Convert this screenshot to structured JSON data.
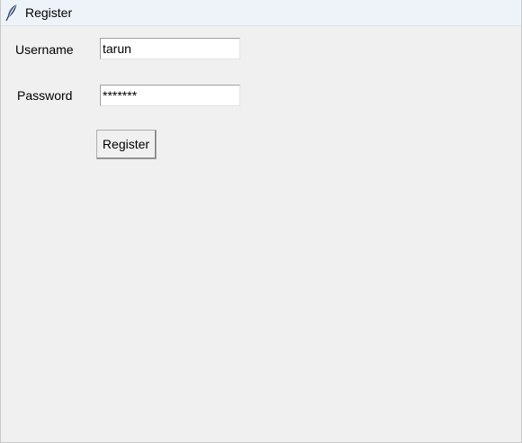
{
  "window": {
    "title": "Register",
    "icon": "feather-icon"
  },
  "form": {
    "username_label": "Username",
    "username_value": "tarun",
    "password_label": "Password",
    "password_value": "*******",
    "register_label": "Register"
  },
  "colors": {
    "window_bg": "#f0f0f0",
    "titlebar_bg": "#eef3f9",
    "entry_bg": "#ffffff"
  }
}
